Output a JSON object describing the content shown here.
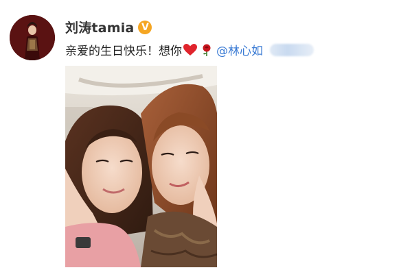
{
  "post": {
    "author": {
      "username": "刘涛tamia",
      "verified_badge": "V",
      "avatar_icon": "avatar-portrait-icon"
    },
    "text": {
      "message": "亲爱的生日快乐！想你",
      "emojis": [
        "red-heart-icon",
        "red-rose-icon"
      ],
      "mention": "@林心如"
    },
    "photo": {
      "description_icon": "selfie-photo"
    }
  },
  "colors": {
    "badge": "#f5a623",
    "mention": "#3b7bd4",
    "heart": "#e0242c"
  }
}
